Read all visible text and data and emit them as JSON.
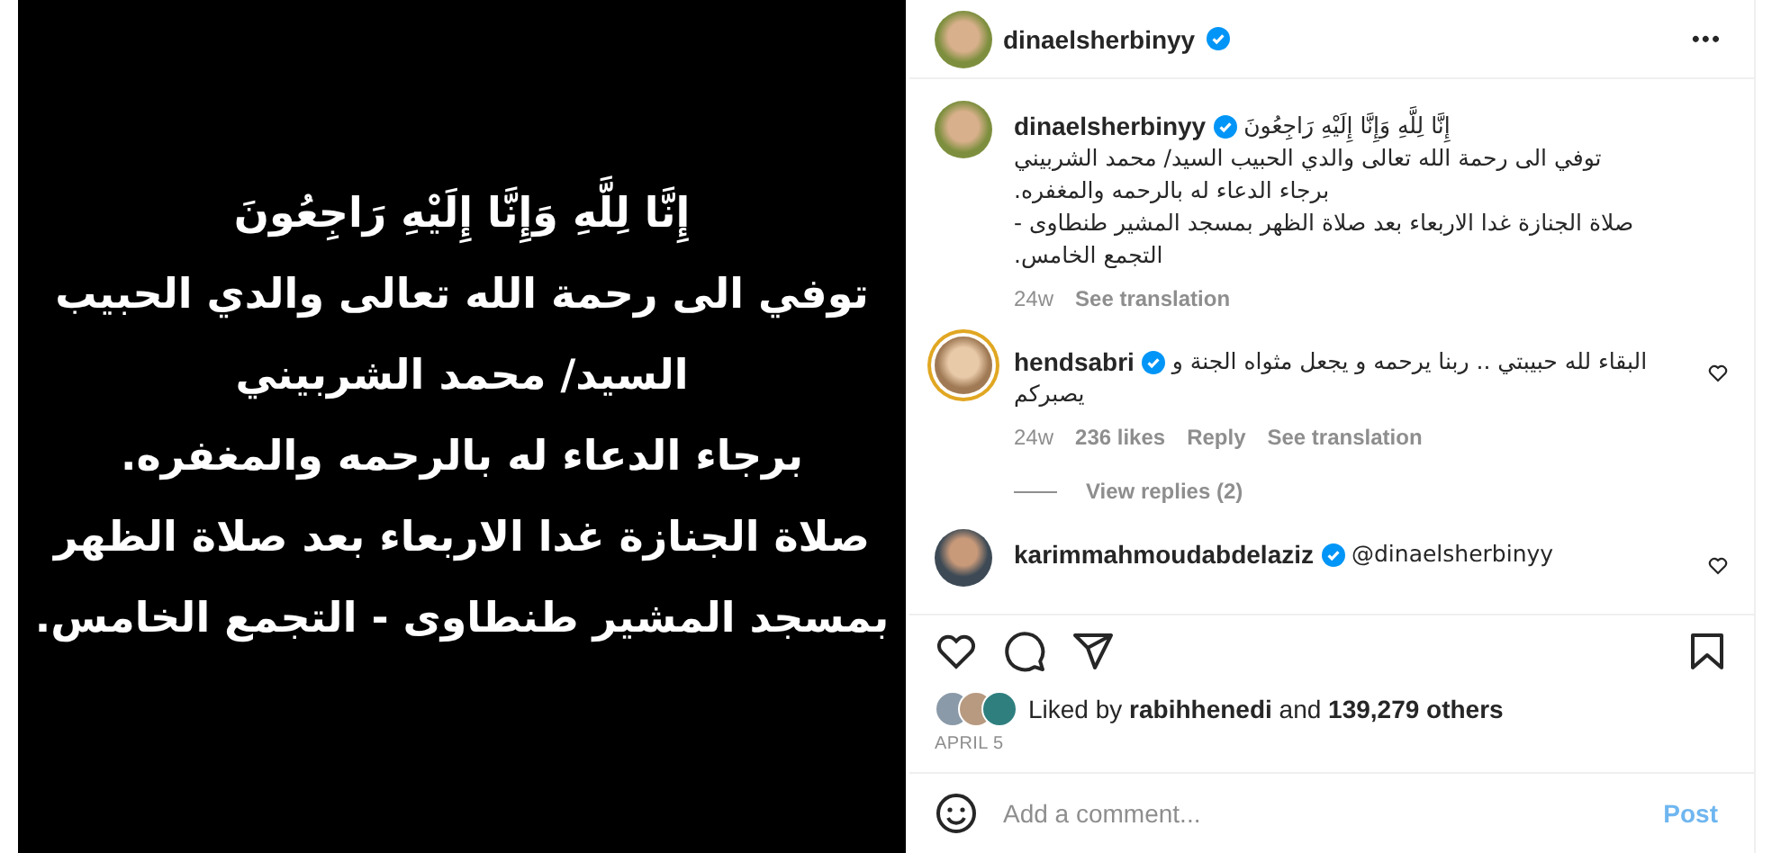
{
  "post_image": {
    "lines": [
      "إِنَّا لِلَّهِ وَإِنَّا إِلَيْهِ رَاجِعُونَ",
      "توفي الى رحمة الله تعالى والدي الحبيب",
      "السيد/ محمد الشربيني",
      "برجاء الدعاء له بالرحمه والمغفره.",
      "صلاة الجنازة غدا الاربعاء بعد صلاة الظهر",
      "بمسجد المشير طنطاوى - التجمع الخامس."
    ]
  },
  "header": {
    "username": "dinaelsherbinyy",
    "verified": true,
    "more": "•••"
  },
  "caption": {
    "username": "dinaelsherbinyy",
    "verified": true,
    "first_line": "إِنَّا لِلَّهِ وَإِنَّا إِلَيْهِ رَاجِعُونَ",
    "lines": [
      "توفي الى رحمة الله تعالى والدي الحبيب السيد/ محمد الشربيني",
      "برجاء الدعاء له بالرحمه والمغفره.",
      "صلاة الجنازة غدا الاربعاء بعد صلاة الظهر بمسجد المشير طنطاوى -",
      "التجمع الخامس."
    ],
    "time": "24w",
    "translate": "See translation"
  },
  "comments": [
    {
      "username": "hendsabri",
      "verified": true,
      "story_ring": true,
      "text_lines": [
        "البقاء لله حبيبتي .. ربنا يرحمه و يجعل مثواه الجنة و",
        "يصبركم"
      ],
      "time": "24w",
      "likes": "236 likes",
      "reply": "Reply",
      "translate": "See translation",
      "view_replies": "View replies (2)"
    },
    {
      "username": "karimmahmoudabdelaziz",
      "verified": true,
      "story_ring": false,
      "text_lines": [
        "@dinaelsherbinyy"
      ]
    }
  ],
  "likes": {
    "text": "Liked by **rabihhenedi** and **139,279 others**"
  },
  "date": "APRIL 5",
  "add_comment": {
    "placeholder": "Add a comment...",
    "post": "Post",
    "post_disabled": true
  }
}
